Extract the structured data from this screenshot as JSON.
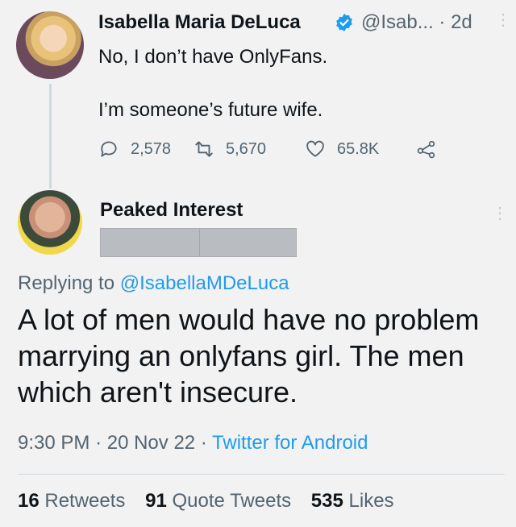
{
  "original_tweet": {
    "author_name": "Isabella Maria DeLuca",
    "handle": "@Isab...",
    "age": "· 2d",
    "more": "⋮",
    "text_line1": "No, I don’t have OnlyFans.",
    "text_line2": "I’m someone’s future wife.",
    "replies": "2,578",
    "retweets": "5,670",
    "likes": "65.8K"
  },
  "reply_tweet": {
    "author_name": "Peaked Interest",
    "more": "⋮",
    "replying_prefix": "Replying to",
    "replying_mention": "@IsabellaMDeLuca",
    "body": "A lot of men would have no problem marrying an onlyfans girl. The men which aren't insecure.",
    "time": "9:30 PM",
    "date": "20 Nov 22",
    "source": "Twitter for Android",
    "sep": "·",
    "retweets_count": "16",
    "retweets_label": "Retweets",
    "quotes_count": "91",
    "quotes_label": "Quote Tweets",
    "likes_count": "535",
    "likes_label": "Likes"
  },
  "colors": {
    "accent": "#1d9bf0",
    "muted": "#536471",
    "background": "#f2f2f2"
  },
  "icons": [
    "verified-badge-icon",
    "reply-icon",
    "retweet-icon",
    "like-icon",
    "share-icon",
    "more-icon"
  ]
}
